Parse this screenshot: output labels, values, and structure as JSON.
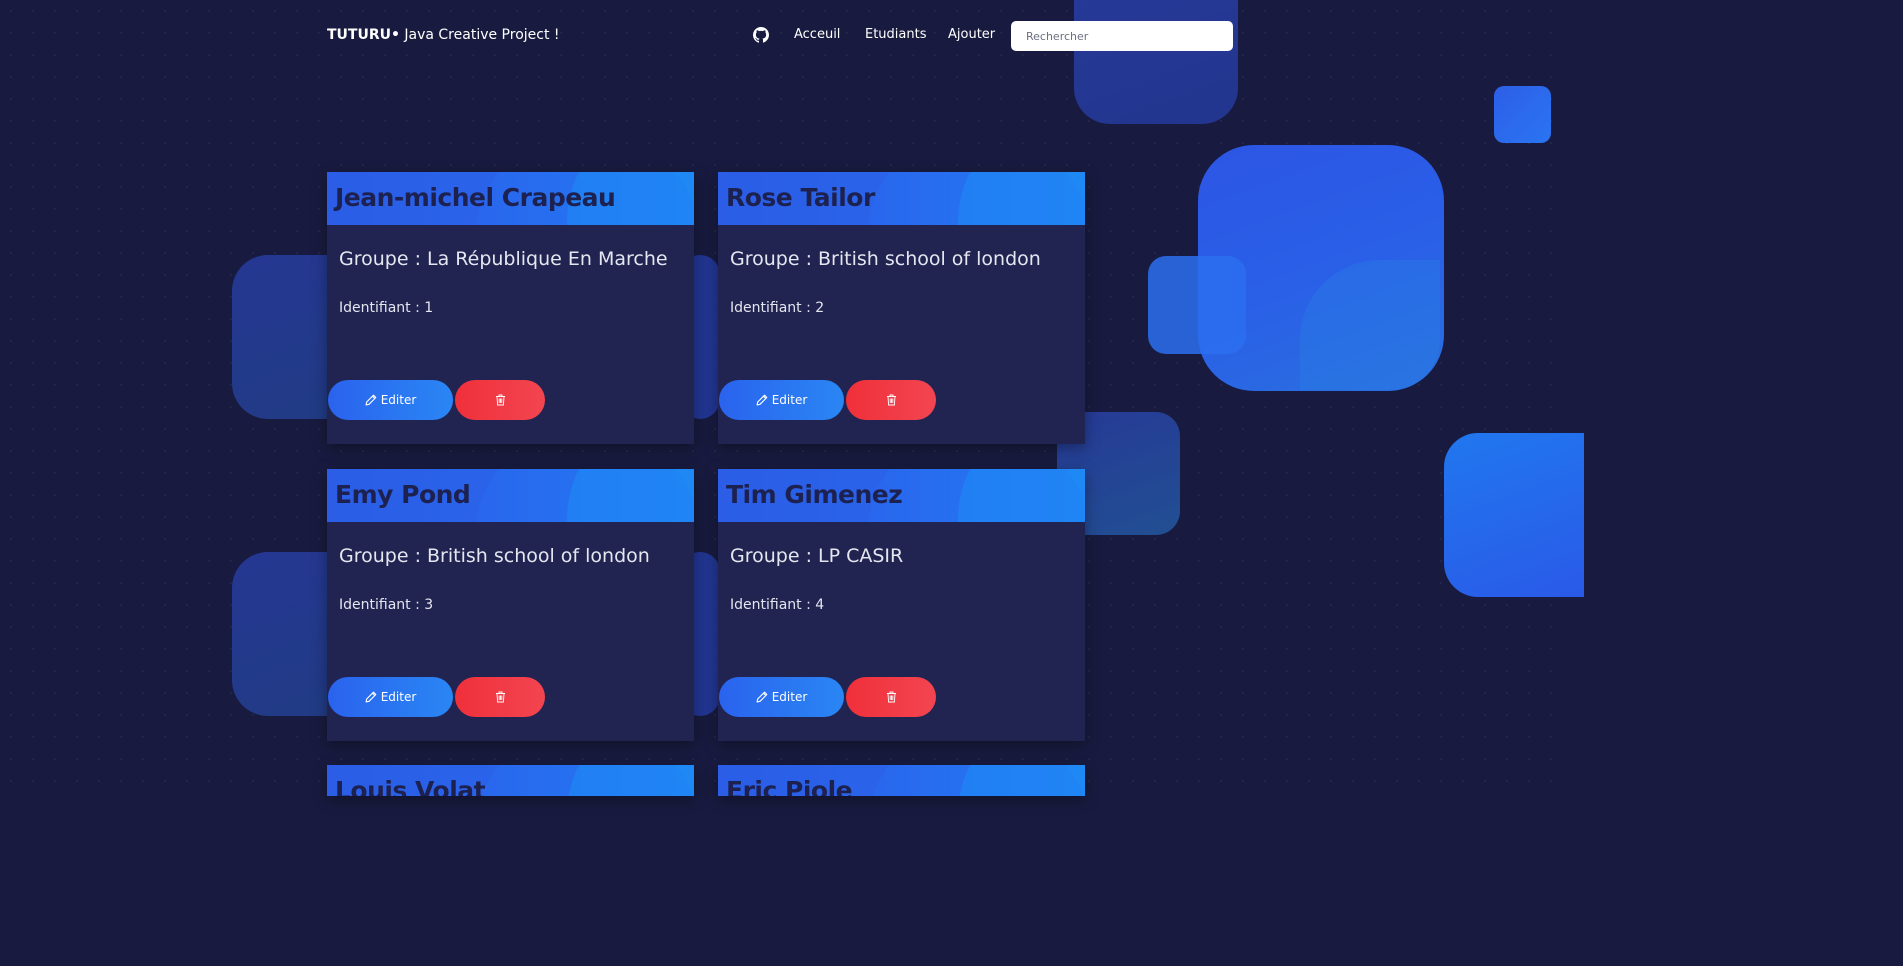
{
  "brand": {
    "strong": "TUTURU•",
    "rest": " Java Creative Project !"
  },
  "nav": {
    "github_icon": "github-icon",
    "links": [
      "Acceuil",
      "Etudiants",
      "Ajouter"
    ],
    "search_placeholder": "Rechercher"
  },
  "labels": {
    "edit": "Editer",
    "edit_icon": "pencil-icon",
    "delete_icon": "trash-icon"
  },
  "colors": {
    "background": "#181b3f",
    "card": "#212350",
    "header_gradient_start": "#2b5de6",
    "header_gradient_end": "#1f86f2",
    "edit_button": "#2a63ee",
    "delete_button": "#f0303a"
  },
  "students": [
    {
      "name": "Jean-michel Crapeau",
      "group": "Groupe : La République En Marche",
      "identifier": "Identifiant : 1"
    },
    {
      "name": "Rose Tailor",
      "group": "Groupe : British school of london",
      "identifier": "Identifiant : 2"
    },
    {
      "name": "Emy Pond",
      "group": "Groupe : British school of london",
      "identifier": "Identifiant : 3"
    },
    {
      "name": "Tim Gimenez",
      "group": "Groupe : LP CASIR",
      "identifier": "Identifiant : 4"
    },
    {
      "name": "Louis Volat"
    },
    {
      "name": "Eric Piole"
    }
  ]
}
